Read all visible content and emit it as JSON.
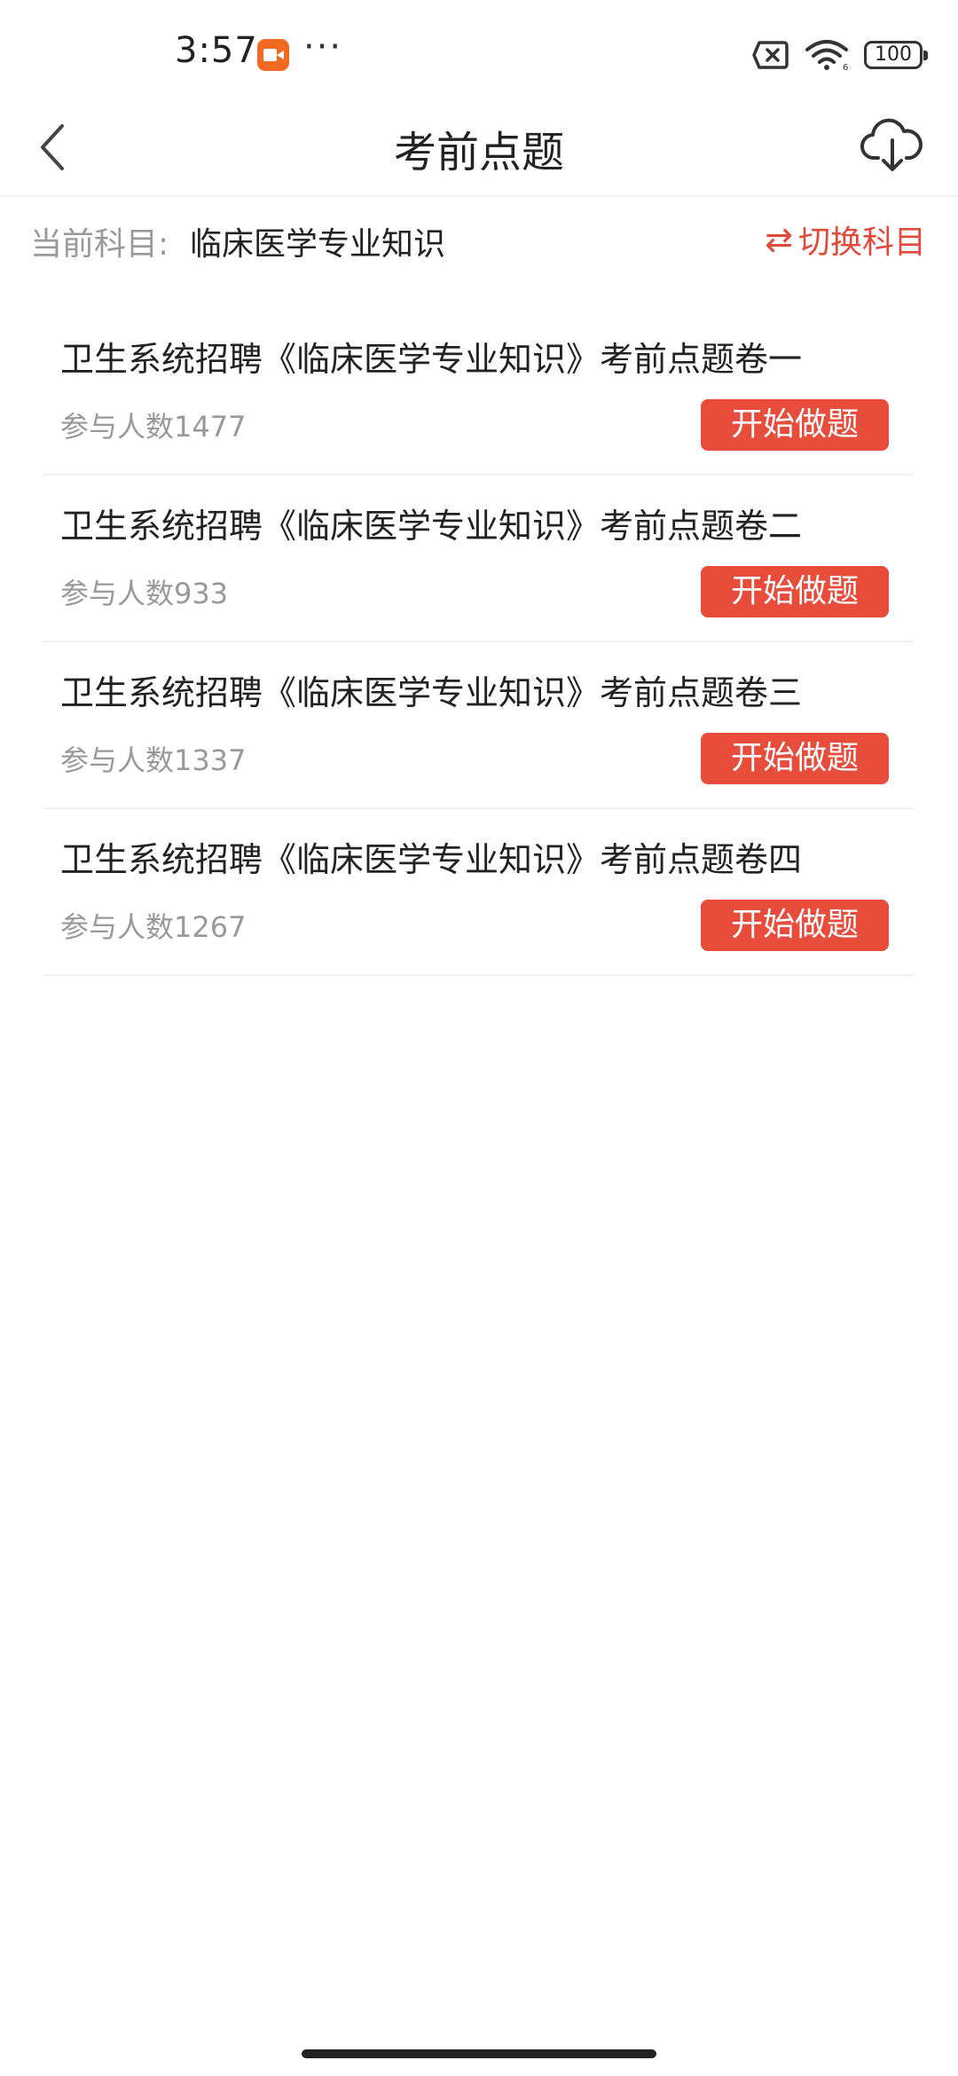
{
  "status_bar": {
    "time": "3:57",
    "dots": "···",
    "battery": "100"
  },
  "header": {
    "title": "考前点题"
  },
  "subject": {
    "label": "当前科目:",
    "name": "临床医学专业知识",
    "switch_label": "切换科目"
  },
  "exams": [
    {
      "title": "卫生系统招聘《临床医学专业知识》考前点题卷一",
      "count_label": "参与人数",
      "count": "1477",
      "button": "开始做题"
    },
    {
      "title": "卫生系统招聘《临床医学专业知识》考前点题卷二",
      "count_label": "参与人数",
      "count": "933",
      "button": "开始做题"
    },
    {
      "title": "卫生系统招聘《临床医学专业知识》考前点题卷三",
      "count_label": "参与人数",
      "count": "1337",
      "button": "开始做题"
    },
    {
      "title": "卫生系统招聘《临床医学专业知识》考前点题卷四",
      "count_label": "参与人数",
      "count": "1267",
      "button": "开始做题"
    }
  ],
  "colors": {
    "accent": "#e84d3b",
    "text_primary": "#222222",
    "text_secondary": "#999999"
  }
}
